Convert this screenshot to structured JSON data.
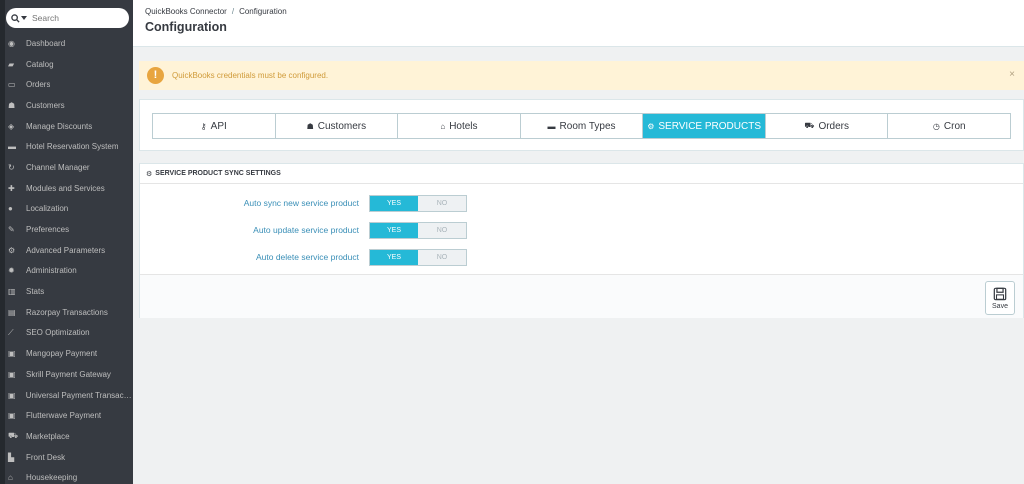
{
  "search": {
    "placeholder": "Search",
    "icon": "search-icon"
  },
  "sidebar": {
    "items": [
      {
        "label": "Dashboard",
        "icon": "dashboard-icon",
        "glyph": "◉"
      },
      {
        "label": "Catalog",
        "icon": "book-icon",
        "glyph": "▰"
      },
      {
        "label": "Orders",
        "icon": "credit-card-icon",
        "glyph": "▭"
      },
      {
        "label": "Customers",
        "icon": "users-icon",
        "glyph": "☗"
      },
      {
        "label": "Manage Discounts",
        "icon": "tag-icon",
        "glyph": "◈"
      },
      {
        "label": "Hotel Reservation System",
        "icon": "bed-icon",
        "glyph": "▬"
      },
      {
        "label": "Channel Manager",
        "icon": "refresh-icon",
        "glyph": "↻"
      },
      {
        "label": "Modules and Services",
        "icon": "puzzle-icon",
        "glyph": "✚"
      },
      {
        "label": "Localization",
        "icon": "globe-icon",
        "glyph": "●"
      },
      {
        "label": "Preferences",
        "icon": "wrench-icon",
        "glyph": "✎"
      },
      {
        "label": "Advanced Parameters",
        "icon": "cogs-icon",
        "glyph": "⚙"
      },
      {
        "label": "Administration",
        "icon": "gear-icon",
        "glyph": "✹"
      },
      {
        "label": "Stats",
        "icon": "bar-chart-icon",
        "glyph": "▥"
      },
      {
        "label": "Razorpay Transactions",
        "icon": "card-icon",
        "glyph": "▤"
      },
      {
        "label": "SEO Optimization",
        "icon": "line-chart-icon",
        "glyph": "⟋"
      },
      {
        "label": "Mangopay Payment",
        "icon": "money-icon",
        "glyph": "▣"
      },
      {
        "label": "Skrill Payment Gateway",
        "icon": "money-icon",
        "glyph": "▣"
      },
      {
        "label": "Universal Payment Transacti...",
        "icon": "money-icon",
        "glyph": "▣"
      },
      {
        "label": "Flutterwave Payment",
        "icon": "money-icon",
        "glyph": "▣"
      },
      {
        "label": "Marketplace",
        "icon": "cart-icon",
        "glyph": "⛟"
      },
      {
        "label": "Front Desk",
        "icon": "building-icon",
        "glyph": "▙"
      },
      {
        "label": "Housekeeping",
        "icon": "home-icon",
        "glyph": "⌂"
      }
    ]
  },
  "header": {
    "breadcrumb": [
      "QuickBooks Connector",
      "Configuration"
    ],
    "breadcrumb_sep": "/",
    "title": "Configuration"
  },
  "alert": {
    "message": "QuickBooks credentials must be configured.",
    "icon": "!",
    "close": "×"
  },
  "tabs": [
    {
      "label": "API",
      "icon": "key-icon",
      "glyph": "⚷",
      "active": false
    },
    {
      "label": "Customers",
      "icon": "user-icon",
      "glyph": "☗",
      "active": false
    },
    {
      "label": "Hotels",
      "icon": "home-icon",
      "glyph": "⌂",
      "active": false
    },
    {
      "label": "Room Types",
      "icon": "bed-icon",
      "glyph": "▬",
      "active": false
    },
    {
      "label": "SERVICE PRODUCTS",
      "icon": "cogs-icon",
      "glyph": "⚙",
      "active": true
    },
    {
      "label": "Orders",
      "icon": "cart-icon",
      "glyph": "⛟",
      "active": false
    },
    {
      "label": "Cron",
      "icon": "clock-icon",
      "glyph": "◷",
      "active": false
    }
  ],
  "panel": {
    "heading": "SERVICE PRODUCT SYNC SETTINGS",
    "heading_glyph": "⚙",
    "settings": [
      {
        "label": "Auto sync new service product",
        "yes": "YES",
        "no": "NO",
        "value": "YES"
      },
      {
        "label": "Auto update service product",
        "yes": "YES",
        "no": "NO",
        "value": "YES"
      },
      {
        "label": "Auto delete service product",
        "yes": "YES",
        "no": "NO",
        "value": "YES"
      }
    ],
    "save_label": "Save"
  },
  "colors": {
    "sidebar_bg": "#363a41",
    "accent": "#25b9d7",
    "alert_bg": "#fff3d7",
    "alert_icon": "#e8a53f"
  }
}
